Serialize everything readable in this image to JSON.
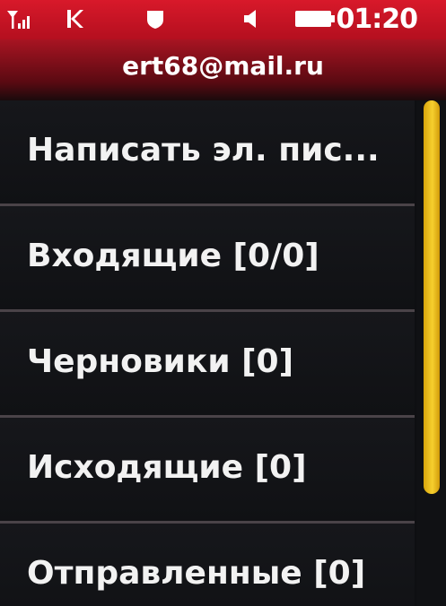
{
  "status_bar": {
    "time": "01:20",
    "icons": [
      "signal-icon",
      "network-icon",
      "shield-icon",
      "volume-icon",
      "battery-icon"
    ],
    "background_color": "#c8121f"
  },
  "header": {
    "title": "ert68@mail.ru"
  },
  "menu": {
    "items": [
      {
        "label": "Написать эл. пис..."
      },
      {
        "label": "Входящие [0/0]"
      },
      {
        "label": "Черновики [0]"
      },
      {
        "label": "Исходящие [0]"
      },
      {
        "label": "Отправленные [0]"
      }
    ]
  },
  "scrollbar": {
    "thumb_color": "#f0c21f",
    "position_fraction": 0.0,
    "visible_fraction": 0.79
  }
}
